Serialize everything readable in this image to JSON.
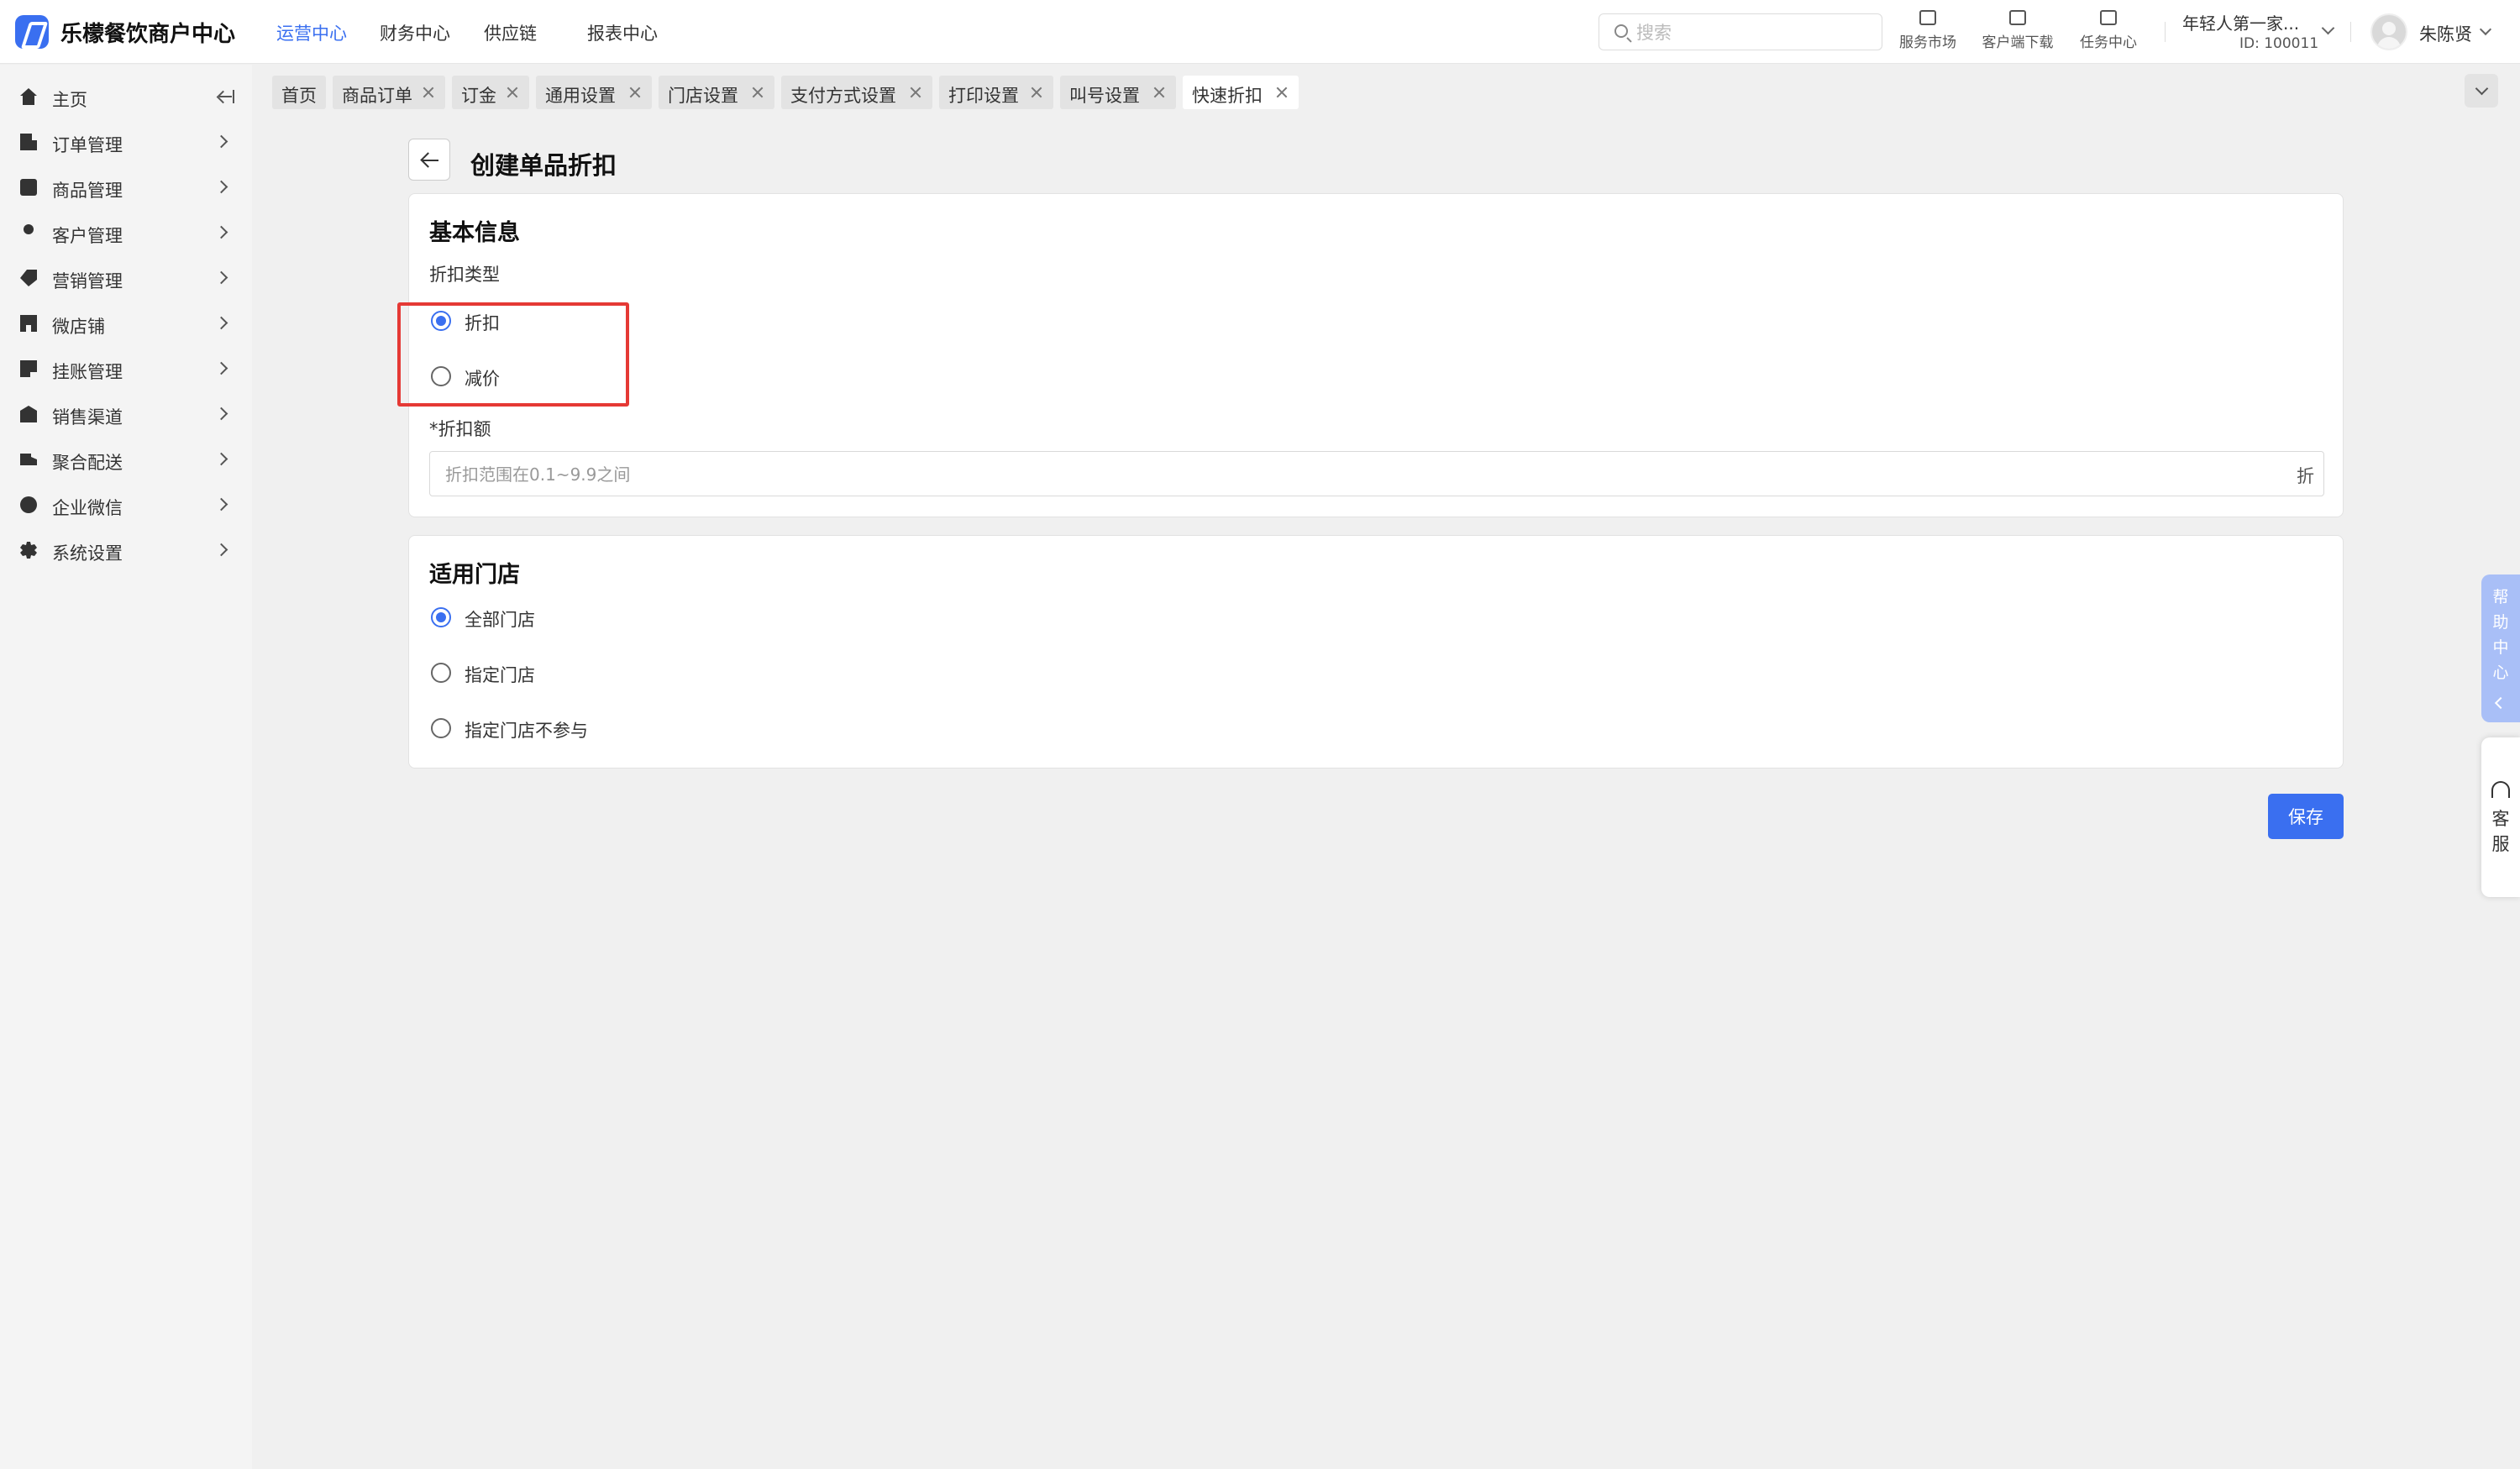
{
  "app": {
    "brand": "乐檬餐饮商户中心"
  },
  "top_nav": [
    {
      "label": "运营中心",
      "active": true
    },
    {
      "label": "财务中心",
      "active": false
    },
    {
      "label": "供应链",
      "active": false
    },
    {
      "label": "报表中心",
      "active": false
    }
  ],
  "search": {
    "placeholder": "搜索",
    "value": ""
  },
  "tools": [
    {
      "label": "服务市场",
      "icon": "store-icon"
    },
    {
      "label": "客户端下载",
      "icon": "download-folder-icon"
    },
    {
      "label": "任务中心",
      "icon": "clipboard-icon"
    }
  ],
  "org": {
    "name": "年轻人第一家...",
    "id": "ID: 100011"
  },
  "user": {
    "name": "朱陈贤"
  },
  "sidebar": {
    "items": [
      {
        "label": "主页",
        "icon": "home-icon"
      },
      {
        "label": "订单管理",
        "icon": "order-icon"
      },
      {
        "label": "商品管理",
        "icon": "goods-icon"
      },
      {
        "label": "客户管理",
        "icon": "user-icon"
      },
      {
        "label": "营销管理",
        "icon": "tag-icon"
      },
      {
        "label": "微店铺",
        "icon": "shop-icon"
      },
      {
        "label": "挂账管理",
        "icon": "ledger-icon"
      },
      {
        "label": "销售渠道",
        "icon": "bank-icon"
      },
      {
        "label": "聚合配送",
        "icon": "truck-icon"
      },
      {
        "label": "企业微信",
        "icon": "chat-icon"
      },
      {
        "label": "系统设置",
        "icon": "gear-icon"
      }
    ]
  },
  "tabs": [
    {
      "label": "首页",
      "closable": false,
      "active": false
    },
    {
      "label": "商品订单",
      "closable": true,
      "active": false
    },
    {
      "label": "订金",
      "closable": true,
      "active": false
    },
    {
      "label": "通用设置",
      "closable": true,
      "active": false
    },
    {
      "label": "门店设置",
      "closable": true,
      "active": false
    },
    {
      "label": "支付方式设置",
      "closable": true,
      "active": false
    },
    {
      "label": "打印设置",
      "closable": true,
      "active": false
    },
    {
      "label": "叫号设置",
      "closable": true,
      "active": false
    },
    {
      "label": "快速折扣",
      "closable": true,
      "active": true
    }
  ],
  "page": {
    "title": "创建单品折扣"
  },
  "basic_info": {
    "title": "基本信息",
    "discount_type_label": "折扣类型",
    "discount_type_options": [
      {
        "label": "折扣",
        "checked": true
      },
      {
        "label": "减价",
        "checked": false
      }
    ],
    "amount_label": "*折扣额",
    "amount_placeholder": "折扣范围在0.1~9.9之间",
    "amount_value": "",
    "amount_suffix": "折"
  },
  "stores": {
    "title": "适用门店",
    "options": [
      {
        "label": "全部门店",
        "checked": true
      },
      {
        "label": "指定门店",
        "checked": false
      },
      {
        "label": "指定门店不参与",
        "checked": false
      }
    ]
  },
  "actions": {
    "save_label": "保存"
  },
  "floating": {
    "help_label": "帮助中心",
    "cs_label": "客服"
  },
  "colors": {
    "accent": "#3a6ff0",
    "highlight": "#e53935"
  }
}
